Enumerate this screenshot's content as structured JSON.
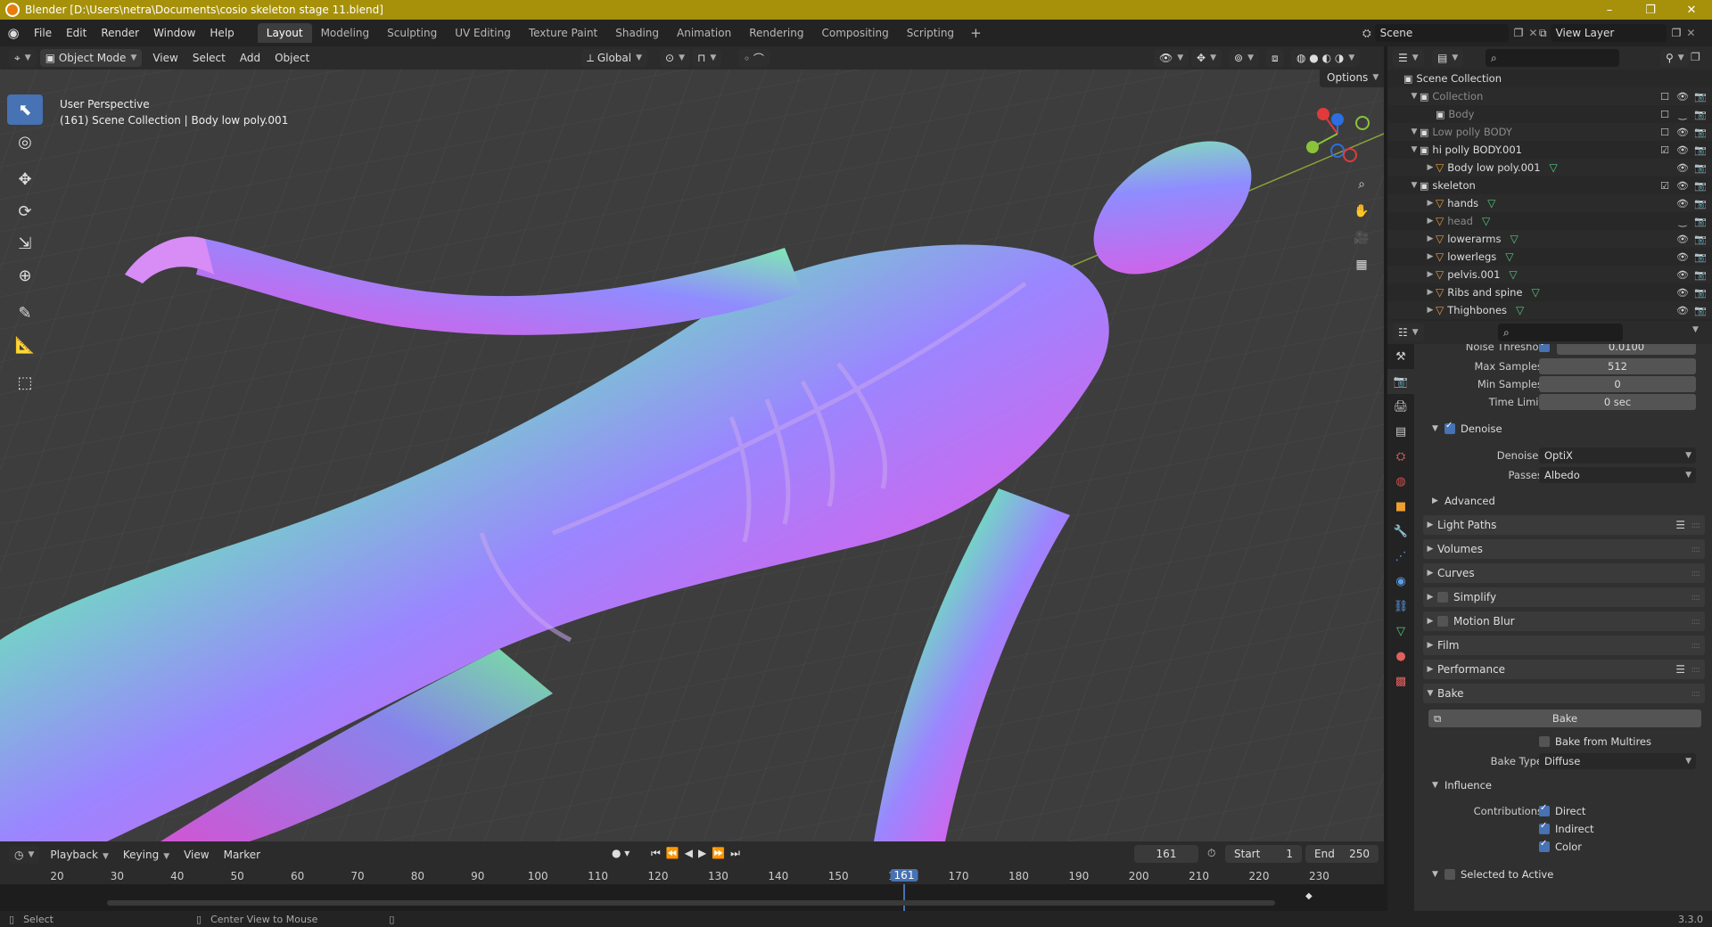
{
  "window": {
    "title": "Blender [D:\\Users\\netra\\Documents\\cosio skeleton stage 11.blend]",
    "controls": [
      "–",
      "❐",
      "✕"
    ]
  },
  "menubar": {
    "menus": [
      "File",
      "Edit",
      "Render",
      "Window",
      "Help"
    ],
    "workspaces": [
      "Layout",
      "Modeling",
      "Sculpting",
      "UV Editing",
      "Texture Paint",
      "Shading",
      "Animation",
      "Rendering",
      "Compositing",
      "Scripting"
    ],
    "active_workspace": "Layout",
    "scene": "Scene",
    "view_layer": "View Layer"
  },
  "viewport_header": {
    "mode": "Object Mode",
    "menus": [
      "View",
      "Select",
      "Add",
      "Object"
    ],
    "orientation": "Global",
    "options": "Options"
  },
  "viewport": {
    "perspective": "User Perspective",
    "context": "(161) Scene Collection | Body low poly.001",
    "gizmo": {
      "x": "X",
      "y": "Y",
      "z": "Z"
    }
  },
  "outliner": {
    "rows": [
      {
        "label": "Scene Collection",
        "type": "scene",
        "depth": 0,
        "dim": false
      },
      {
        "label": "Collection",
        "type": "collection",
        "depth": 1,
        "dim": true
      },
      {
        "label": "Body",
        "type": "collection",
        "depth": 2,
        "dim": true
      },
      {
        "label": "Low polly BODY",
        "type": "collection",
        "depth": 1,
        "dim": true
      },
      {
        "label": "hi polly BODY.001",
        "type": "collection",
        "depth": 1,
        "dim": false
      },
      {
        "label": "Body low poly.001",
        "type": "object",
        "depth": 2,
        "dim": false
      },
      {
        "label": "skeleton",
        "type": "collection",
        "depth": 1,
        "dim": false
      },
      {
        "label": "hands",
        "type": "object",
        "depth": 2,
        "dim": false
      },
      {
        "label": "head",
        "type": "object",
        "depth": 2,
        "dim": true
      },
      {
        "label": "lowerarms",
        "type": "object",
        "depth": 2,
        "dim": false
      },
      {
        "label": "lowerlegs",
        "type": "object",
        "depth": 2,
        "dim": false
      },
      {
        "label": "pelvis.001",
        "type": "object",
        "depth": 2,
        "dim": false
      },
      {
        "label": "Ribs and spine",
        "type": "object",
        "depth": 2,
        "dim": false
      },
      {
        "label": "Thighbones",
        "type": "object",
        "depth": 2,
        "dim": false
      }
    ]
  },
  "properties": {
    "noise_threshold": {
      "label": "Noise Threshold",
      "value": "0.0100"
    },
    "max_samples": {
      "label": "Max Samples",
      "value": "512"
    },
    "min_samples": {
      "label": "Min Samples",
      "value": "0"
    },
    "time_limit": {
      "label": "Time Limit",
      "value": "0 sec"
    },
    "denoise": "Denoise",
    "denoiser": {
      "label": "Denoiser",
      "value": "OptiX"
    },
    "passes": {
      "label": "Passes",
      "value": "Albedo"
    },
    "advanced": "Advanced",
    "panels": [
      "Light Paths",
      "Volumes",
      "Curves",
      "Simplify",
      "Motion Blur",
      "Film",
      "Performance",
      "Bake"
    ],
    "bake_button": "Bake",
    "bake_from_multires": "Bake from Multires",
    "bake_type": {
      "label": "Bake Type",
      "value": "Diffuse"
    },
    "influence": "Influence",
    "contributions": {
      "label": "Contributions",
      "direct": "Direct",
      "indirect": "Indirect",
      "color": "Color"
    },
    "selected_to_active": "Selected to Active"
  },
  "timeline": {
    "menus": [
      "Playback",
      "Keying",
      "View",
      "Marker"
    ],
    "current_frame": "161",
    "start_label": "Start",
    "start": "1",
    "end_label": "End",
    "end": "250",
    "ruler": [
      "20",
      "30",
      "40",
      "50",
      "60",
      "70",
      "80",
      "90",
      "100",
      "110",
      "120",
      "130",
      "140",
      "150",
      "160",
      "170",
      "180",
      "190",
      "200",
      "210",
      "220",
      "230"
    ]
  },
  "statusbar": {
    "select": "Select",
    "center_view": "Center View to Mouse",
    "version": "3.3.0"
  },
  "colors": {
    "accent": "#4772b3",
    "titlebar": "#a7910a",
    "viewport_bg": "#3d3d3d"
  }
}
